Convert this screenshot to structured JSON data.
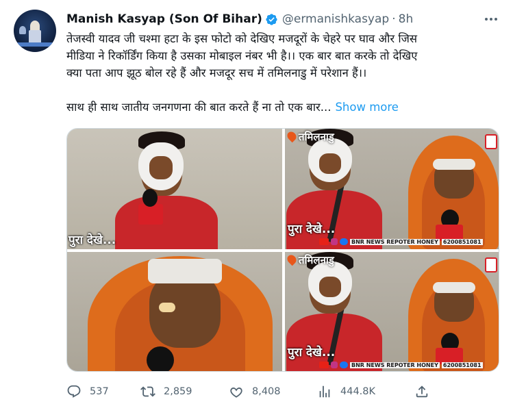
{
  "author": {
    "name": "Manish Kasyap (Son Of Bihar)",
    "handle": "@ermanishkasyap",
    "separator": "·",
    "time": "8h",
    "verified": true
  },
  "tweet": {
    "lines": [
      "तेजस्वी यादव जी चश्मा हटा के इस फोटो को देखिए मजदूरों के चेहरे पर घाव और जिस",
      "मीडिया ने रिकॉर्डिंग किया है उसका मोबाइल नंबर भी है।। एक बार बात करके तो देखिए",
      "क्या पता आप झूठ बोल रहे हैं और मजदूर सच में तमिलनाडु में परेशान हैं।।"
    ],
    "last_line": "साथ ही साथ जातीय जनगणना की बात करते हैं ना तो एक बार...",
    "show_more": "Show more"
  },
  "media": {
    "caption": "पुरा देखे...",
    "location_tag": "तमिलनाडु",
    "footer": {
      "channel": "BNR NEWS REPOTER HONEY",
      "phone": "6200851081"
    }
  },
  "actions": {
    "replies": "537",
    "retweets": "2,859",
    "likes": "8,408",
    "views": "444.8K"
  },
  "colors": {
    "accent": "#1d9bf0",
    "secondary_text": "#536471",
    "primary_text": "#0f1419"
  },
  "icons": [
    "verified-badge-icon",
    "more-options-icon",
    "reply-icon",
    "retweet-icon",
    "like-icon",
    "views-icon",
    "share-icon"
  ]
}
